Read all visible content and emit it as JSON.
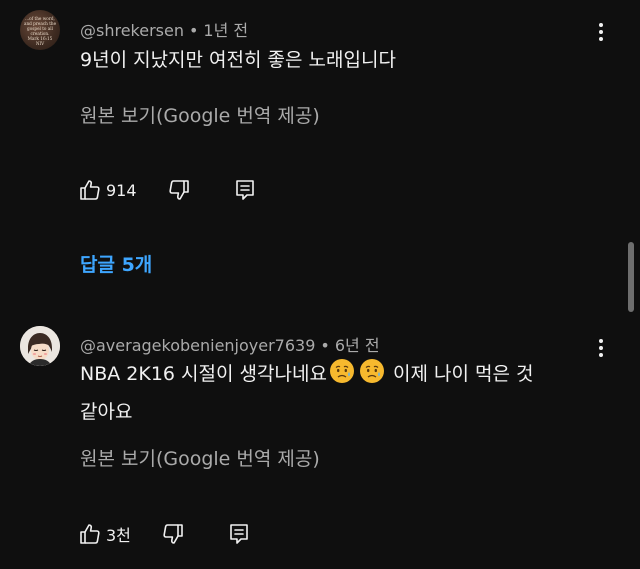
{
  "comments": [
    {
      "avatar_text": "...of the word,\nand preach the\ngospel to all\ncreation.\nMark 16:15 NIV",
      "username": "@shrekersen",
      "separator": "•",
      "timestamp": "1년 전",
      "text": "9년이 지났지만 여전히 좋은 노래입니다",
      "translate_label": "원본 보기(Google 번역 제공)",
      "likes": "914",
      "replies_label": "답글 5개"
    },
    {
      "username": "@averagekobenienjoyer7639",
      "separator": "•",
      "timestamp": "6년 전",
      "text_part1": "NBA 2K16 시절이 생각나네요",
      "text_part2": " 이제 나이 먹은 것",
      "text_line2": "같아요",
      "emojis": [
        "sad-but-relieved-face",
        "sad-but-relieved-face"
      ],
      "translate_label": "원본 보기(Google 번역 제공)",
      "likes": "3천"
    }
  ],
  "colors": {
    "background": "#0f0f0f",
    "text_primary": "#f1f1f1",
    "text_secondary": "#aaaaaa",
    "link_blue": "#3ea6ff"
  }
}
